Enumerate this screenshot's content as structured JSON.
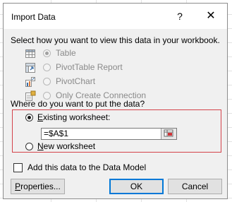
{
  "dialog": {
    "title": "Import Data",
    "help_glyph": "?",
    "close_glyph": "✕"
  },
  "view_section": {
    "prompt": "Select how you want to view this data in your workbook.",
    "options": [
      {
        "label": "Table",
        "icon": "table-icon",
        "selected": true,
        "enabled": false
      },
      {
        "label": "PivotTable Report",
        "icon": "pivottable-icon",
        "selected": false,
        "enabled": false
      },
      {
        "label": "PivotChart",
        "icon": "pivotchart-icon",
        "selected": false,
        "enabled": false
      },
      {
        "label": "Only Create Connection",
        "icon": "connection-icon",
        "selected": false,
        "enabled": false
      }
    ]
  },
  "destination_section": {
    "prompt": "Where do you want to put the data?",
    "existing_label_first": "E",
    "existing_label_rest": "xisting worksheet:",
    "existing_selected": true,
    "cell_reference": "=$A$1",
    "new_label_first": "N",
    "new_label_rest": "ew worksheet",
    "new_selected": false,
    "highlight_color": "#d4424a"
  },
  "data_model": {
    "label": "Add this data to the Data Model",
    "checked": false
  },
  "buttons": {
    "properties_first": "P",
    "properties_rest": "roperties...",
    "ok": "OK",
    "cancel": "Cancel"
  }
}
